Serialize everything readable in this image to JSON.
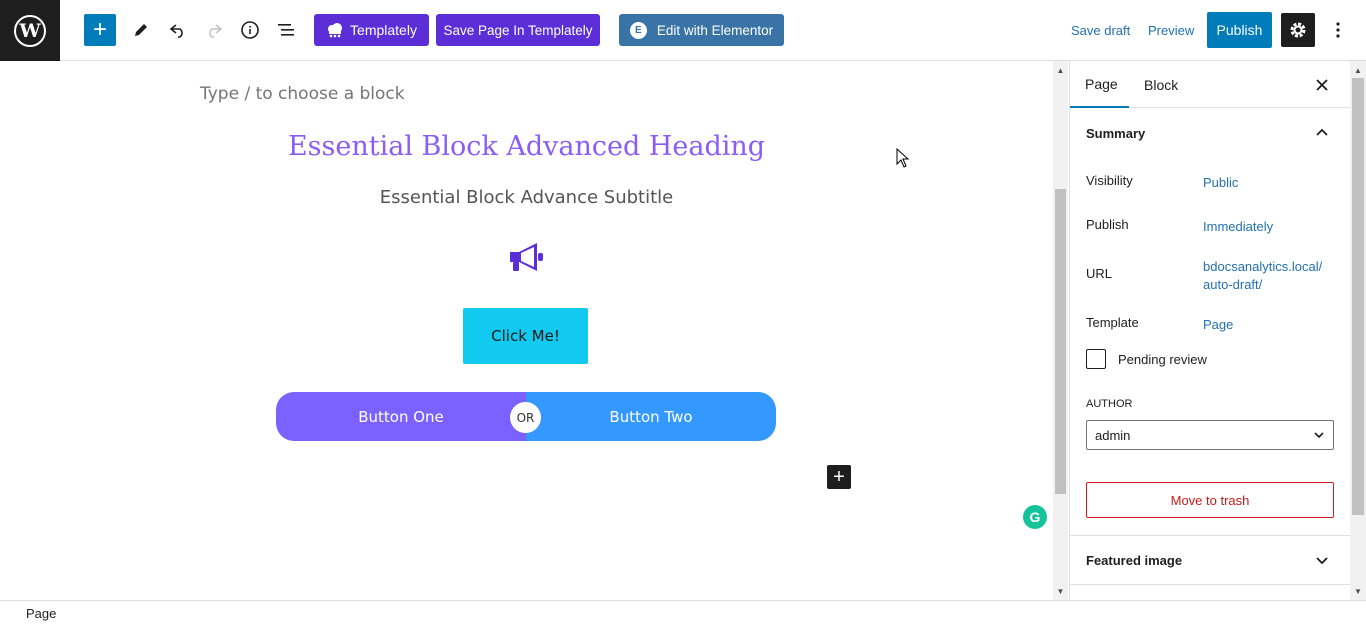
{
  "toolbar": {
    "templately_label": "Templately",
    "save_templately_label": "Save Page In Templately",
    "elementor_label": "Edit with Elementor",
    "save_draft_label": "Save draft",
    "preview_label": "Preview",
    "publish_label": "Publish",
    "add_symbol": "+",
    "elementor_glyph": "E"
  },
  "canvas": {
    "placeholder": "Type / to choose a block",
    "heading": "Essential Block Advanced Heading",
    "subtitle": "Essential Block Advance Subtitle",
    "click_button": "Click Me!",
    "button_one": "Button One",
    "button_two": "Button Two",
    "or_label": "OR",
    "inserter_symbol": "+",
    "grammarly_letter": "G",
    "colors": {
      "heading": "#8b5cf6",
      "megaphone": "#5b2ed8",
      "click_button": "#12c9ef",
      "button_one": "#7b61ff",
      "button_two": "#3399ff"
    }
  },
  "sidebar": {
    "tabs": [
      {
        "label": "Page",
        "active": true
      },
      {
        "label": "Block",
        "active": false
      }
    ],
    "summary": {
      "title": "Summary",
      "rows": [
        {
          "label": "Visibility",
          "value": "Public"
        },
        {
          "label": "Publish",
          "value": "Immediately"
        },
        {
          "label": "URL",
          "value": "bdocsanalytics.local/ auto-draft/"
        },
        {
          "label": "Template",
          "value": "Page"
        }
      ],
      "pending_review_label": "Pending review",
      "pending_review_checked": false,
      "author_label": "AUTHOR",
      "author_value": "admin",
      "trash_label": "Move to trash"
    },
    "featured_image_title": "Featured image"
  },
  "footer": {
    "breadcrumb": "Page"
  }
}
